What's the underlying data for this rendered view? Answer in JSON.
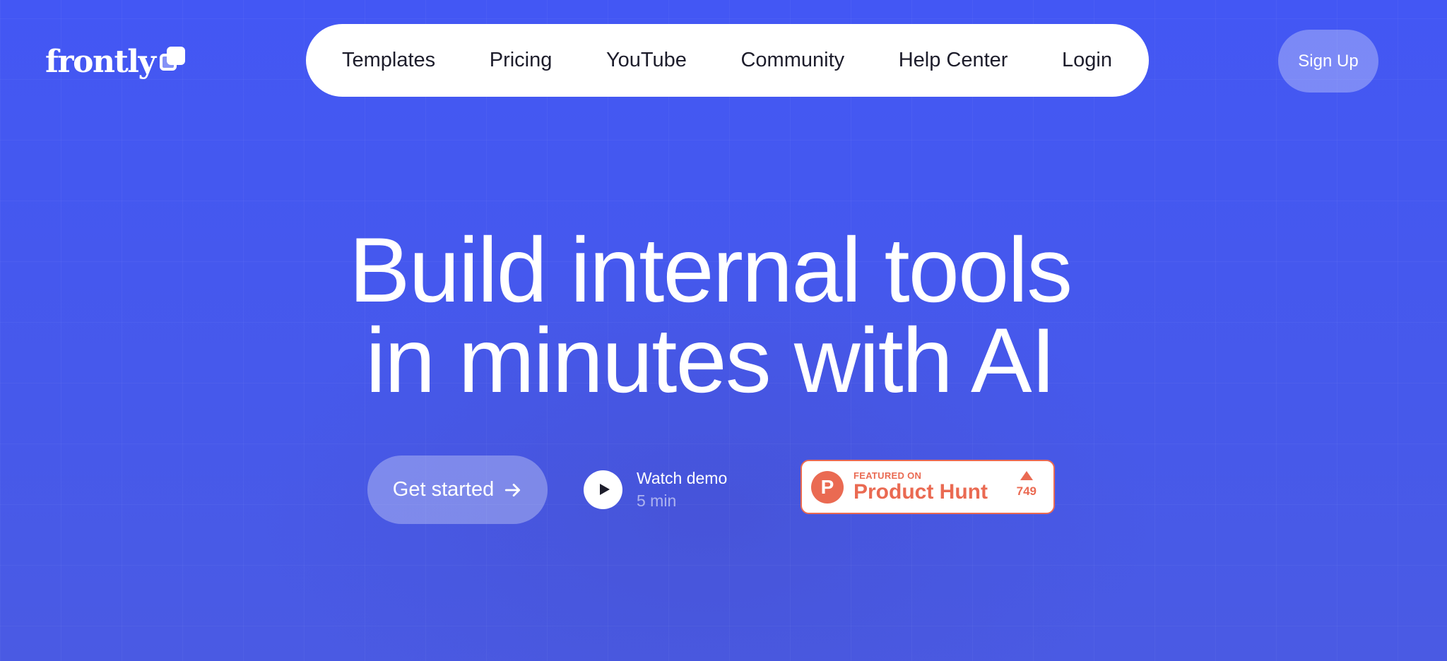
{
  "brand": {
    "logo_text": "frontly",
    "logo_icon": "frontly-squares-icon"
  },
  "nav": {
    "items": [
      {
        "label": "Templates"
      },
      {
        "label": "Pricing"
      },
      {
        "label": "YouTube"
      },
      {
        "label": "Community"
      },
      {
        "label": "Help Center"
      },
      {
        "label": "Login"
      }
    ],
    "signup_label": "Sign Up"
  },
  "hero": {
    "headline_line1": "Build internal tools",
    "headline_line2": "in minutes with AI"
  },
  "cta": {
    "get_started_label": "Get started",
    "get_started_icon": "arrow-right-icon",
    "demo_title": "Watch demo",
    "demo_duration": "5 min",
    "demo_icon": "play-icon"
  },
  "product_hunt": {
    "featured_label": "FEATURED ON",
    "name": "Product Hunt",
    "logo_letter": "P",
    "votes": "749"
  },
  "colors": {
    "background": "#4457f0",
    "nav_background": "#ffffff",
    "product_hunt_accent": "#ea6a52"
  }
}
